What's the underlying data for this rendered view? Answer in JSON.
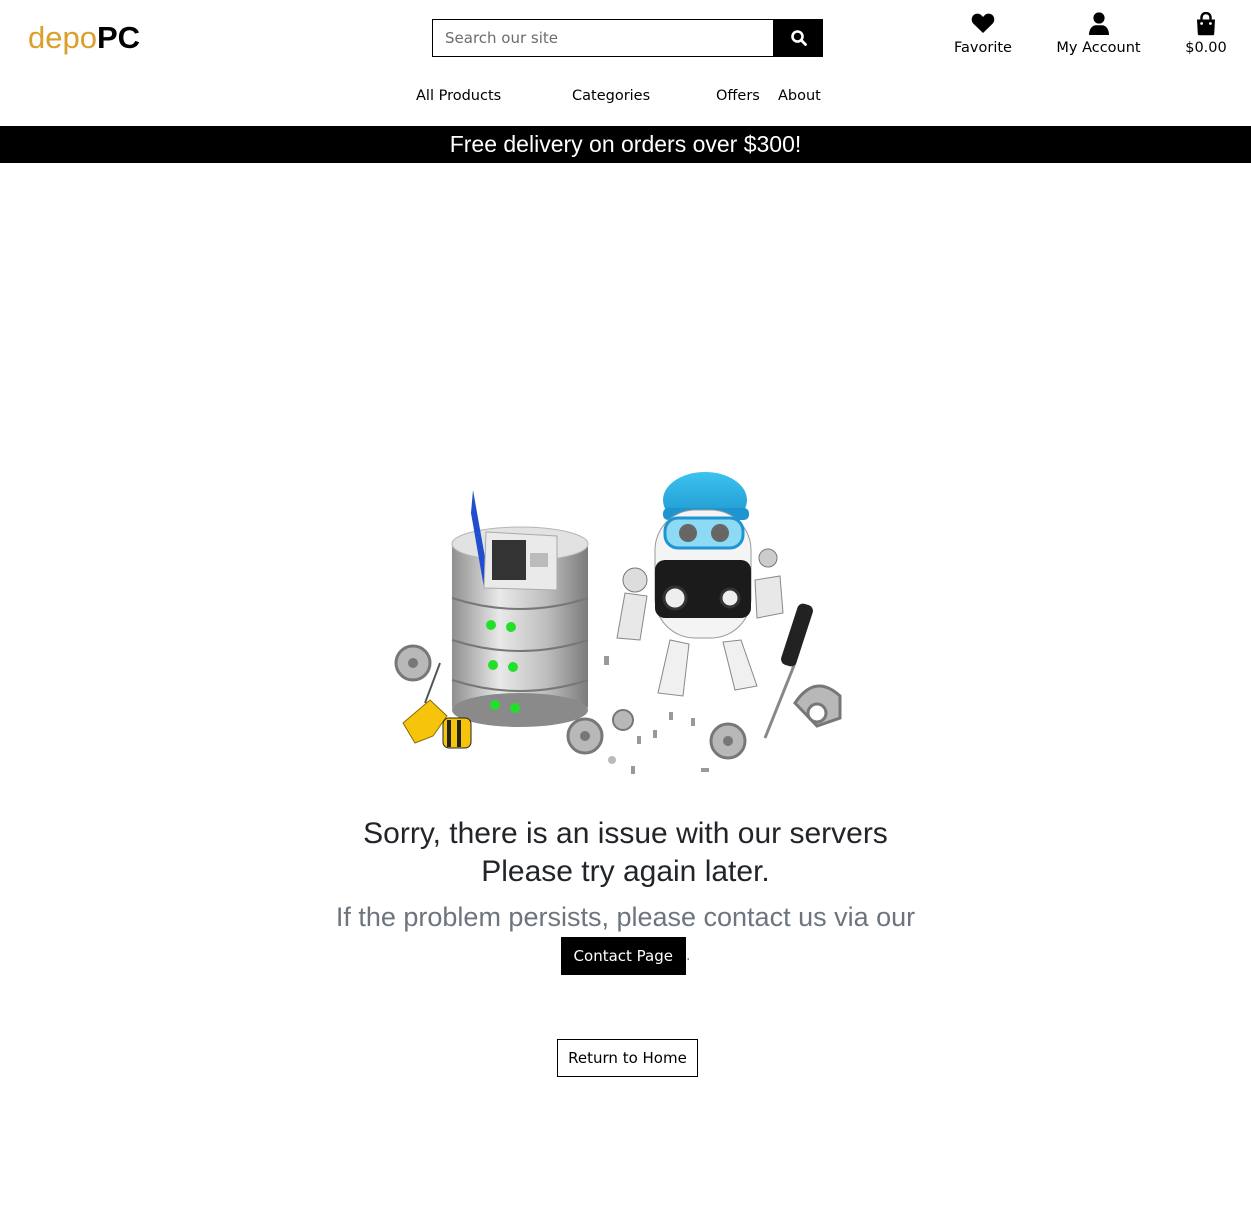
{
  "header": {
    "logo_part1": "depo",
    "logo_part2": "PC",
    "search_placeholder": "Search our site",
    "search_icon": "magnifier-icon",
    "favorite_label": "Favorite",
    "favorite_icon": "heart-icon",
    "account_label": "My Account",
    "account_icon": "user-icon",
    "cart_label": "$0.00",
    "cart_icon": "shopping-bag-icon"
  },
  "nav": {
    "items": [
      {
        "label": "All Products"
      },
      {
        "label": "Categories"
      },
      {
        "label": "Offers"
      },
      {
        "label": "About"
      }
    ]
  },
  "banner": {
    "text": "Free delivery on orders over $300!"
  },
  "error": {
    "illustration": "robot-repairing-server-illustration",
    "line1": "Sorry, there is an issue with our servers",
    "line2": "Please try again later.",
    "line3": "If the problem persists, please contact us via our",
    "contact_label": "Contact Page",
    "contact_suffix": ".",
    "return_label": "Return to Home"
  },
  "colors": {
    "brand_accent": "#d9a02a",
    "banner_bg": "#000000",
    "banner_text": "#ffffff",
    "muted_text": "#6c757d",
    "heading_text": "#212529"
  }
}
